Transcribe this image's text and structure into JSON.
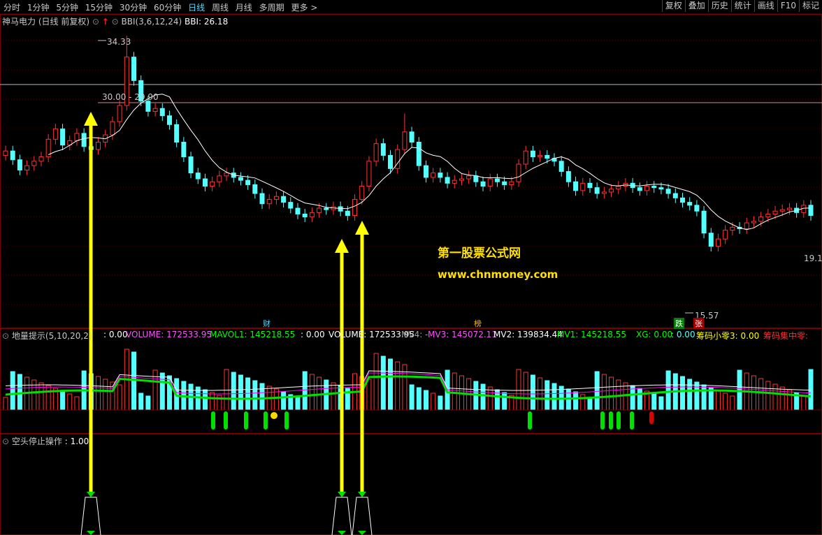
{
  "toolbar": {
    "periods": [
      "分时",
      "1分钟",
      "5分钟",
      "15分钟",
      "30分钟",
      "60分钟",
      "日线",
      "周线",
      "月线",
      "多周期",
      "更多"
    ],
    "active_period": "日线",
    "more_arrow": ">",
    "right_buttons": [
      "复权",
      "叠加",
      "历史",
      "统计",
      "画线",
      "F10",
      "标记"
    ],
    "end_arrow": "▲"
  },
  "main_panel": {
    "stock_label": "神马电力",
    "mode_label": "(日线 前复权)",
    "indicator_label": "BBI(3,6,12,24)",
    "bbi_value": "BBI: 26.18",
    "high_label": "34.33",
    "range_label": "30.00 - 29.90",
    "low_label": "15.57",
    "last_label": "19.1",
    "tag_cai": "财",
    "tag_bang": "榜",
    "tag_die": "跌",
    "tag_zhang": "张",
    "watermark_title": "第一股票公式网",
    "watermark_url": "www.chnmoney.com"
  },
  "volume_panel": {
    "title": "地量提示(5,10,20,2)",
    "v0": ": 0.00",
    "volume": "VOLUME: 172533.95",
    "mavol1": "MAVOL1: 145218.55",
    "v1": ": 0.00",
    "volume2": "VOLUME: 172533.95",
    "mv4": "MV4: -",
    "mv3": "MV3: 145072.11",
    "mv2": "MV2: 139834.44",
    "mv1": "MV1: 145218.55",
    "xg": "XG: 0.00",
    "v2": ": 0.00",
    "chouma_xiaoling": "筹码小零3: 0.00",
    "chouma_jizhong": "筹码集中零:"
  },
  "signal_panel": {
    "title": "空头停止操作",
    "value": ": 1.00"
  },
  "colors": {
    "up": "#ff3232",
    "down": "#54ffff",
    "bbi": "#ffffff",
    "arrow": "#ffff00",
    "grid": "#5a0000",
    "ma_green": "#00e000",
    "ma_magenta": "#ff00ff"
  },
  "chart_data": {
    "type": "candlestick",
    "price_axis_labels": [
      "34.33",
      "30.00 - 29.90",
      "15.57",
      "19.1"
    ],
    "high": 34.33,
    "low": 15.57,
    "last": 19.1,
    "bbi": 26.18,
    "volume": 172533.95,
    "mavol1": 145218.55,
    "mv3": 145072.11,
    "mv2": 139834.44,
    "mv1": 145218.55,
    "signal": 1.0
  }
}
